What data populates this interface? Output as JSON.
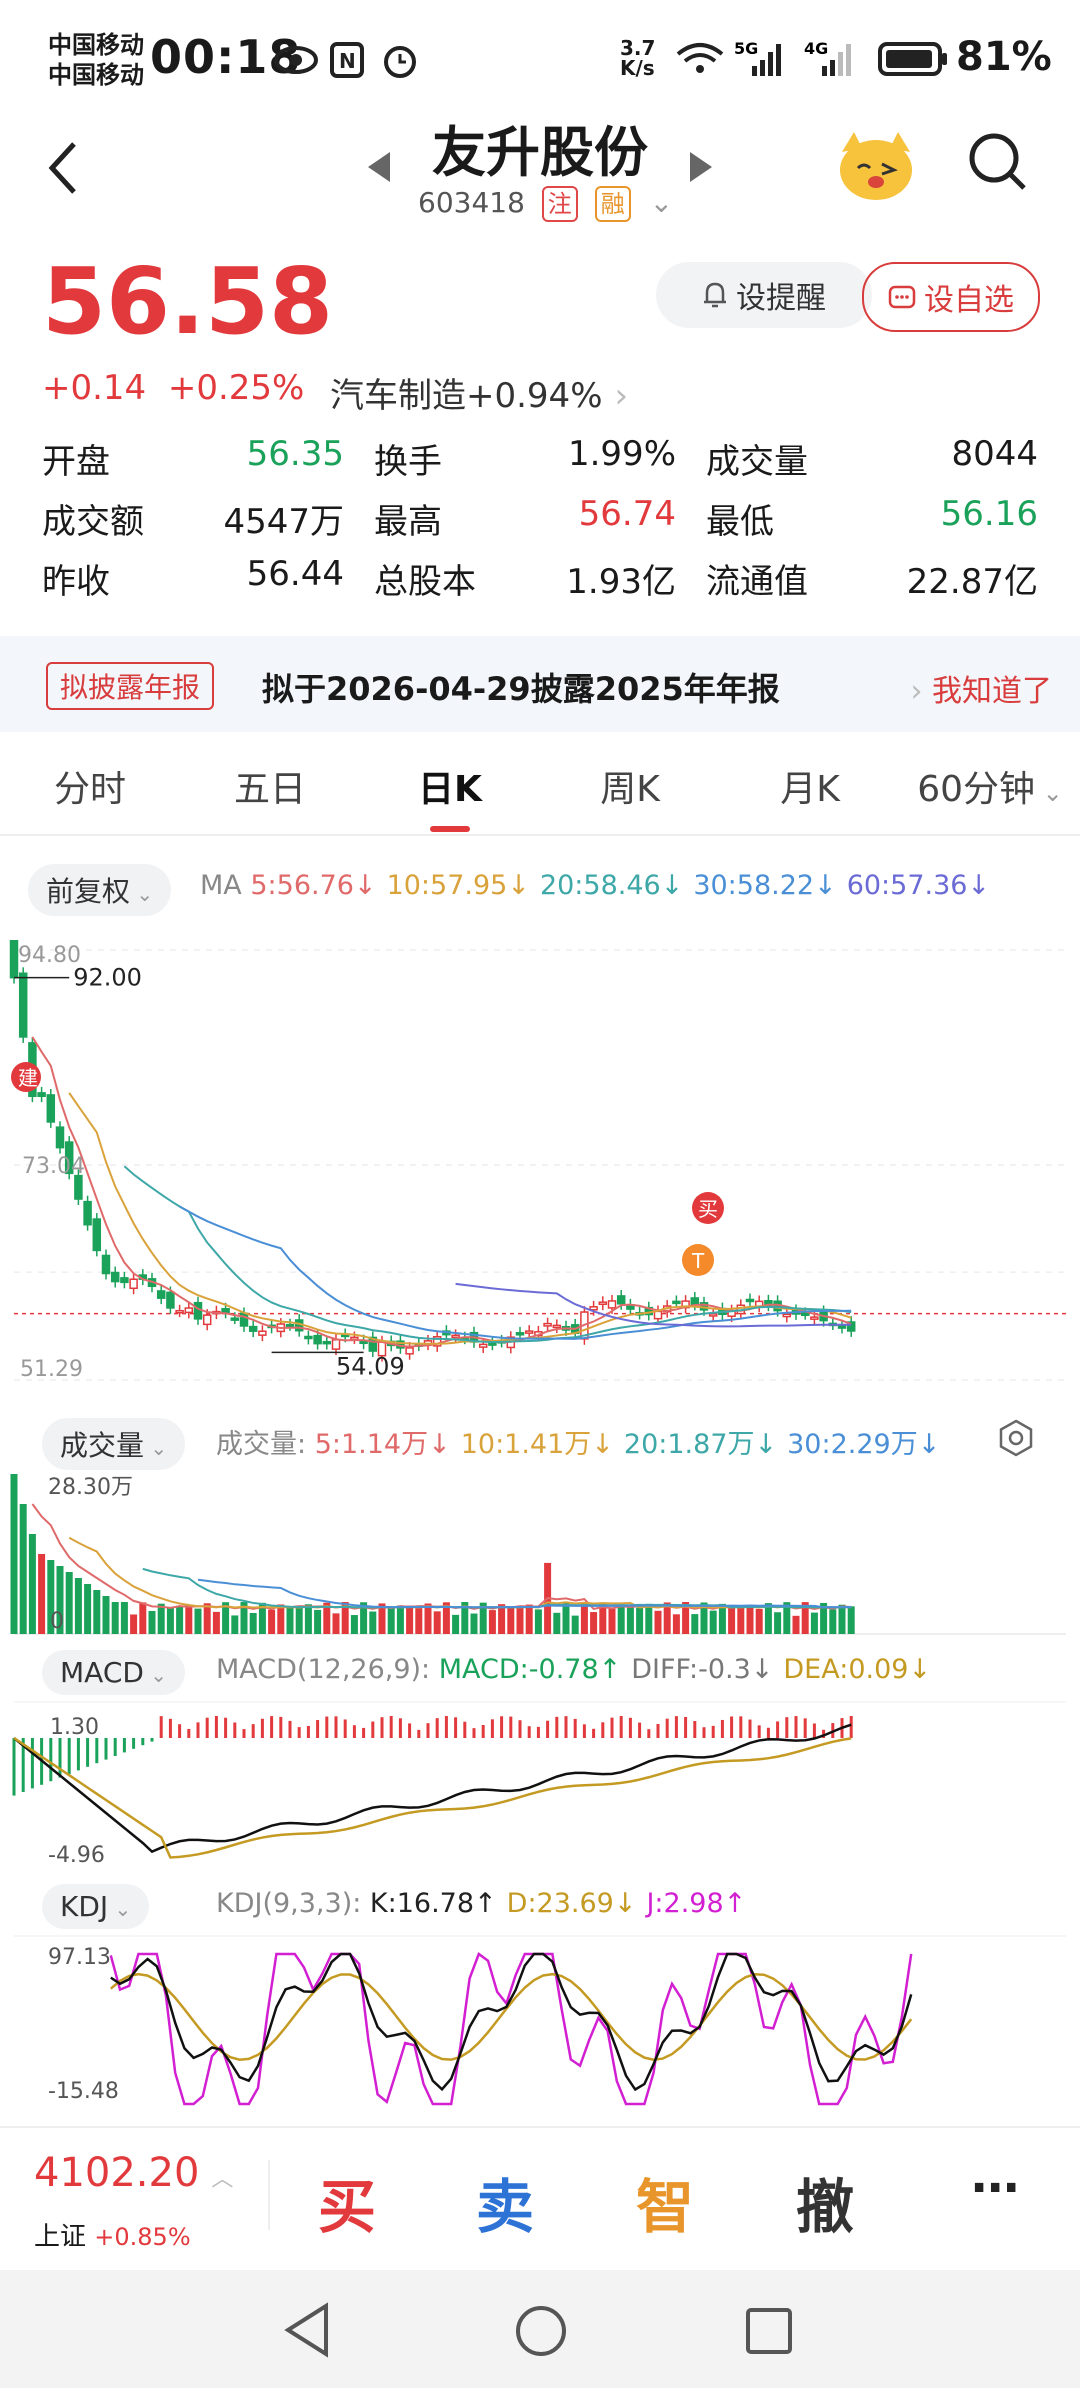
{
  "status_bar": {
    "carrier1": "中国移动",
    "carrier2": "中国移动",
    "time": "00:18",
    "net_speed_top": "3.7",
    "net_speed_bottom": "K/s",
    "battery": "81%"
  },
  "header": {
    "title": "友升股份",
    "code": "603418",
    "tag1": "注",
    "tag2": "融"
  },
  "quote": {
    "price": "56.58",
    "change": "+0.14",
    "change_pct": "+0.25%",
    "sector": "汽车制造+0.94%",
    "alert_label": "设提醒",
    "add_label": "设自选"
  },
  "stats": [
    [
      {
        "label": "开盘",
        "value": "56.35",
        "color": "green"
      },
      {
        "label": "换手",
        "value": "1.99%",
        "color": "normal"
      },
      {
        "label": "成交量",
        "value": "8044",
        "color": "normal"
      }
    ],
    [
      {
        "label": "成交额",
        "value": "4547万",
        "color": "normal"
      },
      {
        "label": "最高",
        "value": "56.74",
        "color": "red"
      },
      {
        "label": "最低",
        "value": "56.16",
        "color": "green"
      }
    ],
    [
      {
        "label": "昨收",
        "value": "56.44",
        "color": "normal"
      },
      {
        "label": "总股本",
        "value": "1.93亿",
        "color": "normal"
      },
      {
        "label": "流通值",
        "value": "22.87亿",
        "color": "normal"
      }
    ]
  ],
  "notice": {
    "tag": "拟披露年报",
    "text": "拟于2026-04-29披露2025年年报",
    "action": "我知道了"
  },
  "tabs": [
    "分时",
    "五日",
    "日K",
    "周K",
    "月K",
    "60分钟"
  ],
  "kline": {
    "adj_label": "前复权",
    "ma_prefix": "MA",
    "ma": [
      {
        "label": "5:56.76↓",
        "color": "#e06a6a"
      },
      {
        "label": "10:57.95↓",
        "color": "#d9a23a"
      },
      {
        "label": "20:58.46↓",
        "color": "#3ea7a7"
      },
      {
        "label": "30:58.22↓",
        "color": "#4a8fd6"
      },
      {
        "label": "60:57.36↓",
        "color": "#6b6bd6"
      }
    ],
    "y_top": "94.80",
    "y_mid": "73.04",
    "y_bot": "51.29",
    "high_mark": "92.00",
    "low_mark": "54.09",
    "badge_jian": "建",
    "badge_mai": "买",
    "badge_t": "T"
  },
  "volume": {
    "label": "成交量",
    "legend_prefix": "成交量:",
    "items": [
      {
        "text": "5:1.14万↓",
        "color": "#e06a6a"
      },
      {
        "text": "10:1.41万↓",
        "color": "#d9a23a"
      },
      {
        "text": "20:1.87万↓",
        "color": "#3ea7a7"
      },
      {
        "text": "30:2.29万↓",
        "color": "#4a8fd6"
      }
    ],
    "y_top": "28.30万",
    "y_zero": "0"
  },
  "macd": {
    "label": "MACD",
    "params": "MACD(12,26,9):",
    "items": [
      {
        "text": "MACD:-0.78↑",
        "color": "#1aa25a"
      },
      {
        "text": "DIFF:-0.3↓",
        "color": "#777"
      },
      {
        "text": "DEA:0.09↓",
        "color": "#c49a22"
      }
    ],
    "y_top": "1.30",
    "y_bot": "-4.96"
  },
  "kdj": {
    "label": "KDJ",
    "params": "KDJ(9,3,3):",
    "items": [
      {
        "text": "K:16.78↑",
        "color": "#222"
      },
      {
        "text": "D:23.69↓",
        "color": "#c49a22"
      },
      {
        "text": "J:2.98↑",
        "color": "#d21fd2"
      }
    ],
    "y_top": "97.13",
    "y_bot": "-15.48"
  },
  "bottom": {
    "index_value": "4102.20",
    "index_name": "上证",
    "index_change": "+0.85%",
    "buy": "买",
    "sell": "卖",
    "smart": "智",
    "cancel": "撤",
    "more": "⋯"
  }
}
